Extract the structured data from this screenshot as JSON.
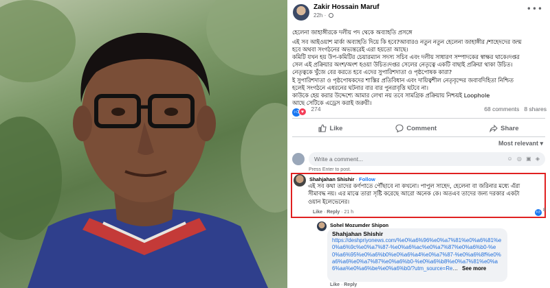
{
  "post": {
    "author": "Zakir Hossain Maruf",
    "time": "22h",
    "more_icon": "more-dots-icon",
    "body_lines": [
      "হেলেনা জাহাঙ্গীরকে দলীয় পদ থেকে অব্যাহতি প্রসঙ্গে",
      "এই সব আইওয়াশ মার্কা অব্যাহতি দিয়ে কি হবে?আবারও নতুন নতুন হেলেনা জাহাঙ্গীর /শাহেদদের জন্ম",
      "হবে অথবা সংগঠনের অভ্যন্তরেই এরা হয়তো আছে।",
      "কমিটি যখন হয় উপ-কমিটির চেয়ারম্যান সদস্য সচিব এবং দলীয় সাধারণ সম্পাদকের স্বাক্ষর থাকে।দপ্তর",
      "সেল এই প্রক্রিয়ার অংশ/অংশ হওয়া উচিত।দপ্তর সেলের নেতৃত্বে একটি বাছাই প্রক্রিয়া থাকা উচিত।",
      "নেতৃত্বকে খুঁজে বের করতে হবে এদের সুপারিশদাতা ও পৃষ্ঠপোষক কারা?",
      "ই সুপারিশদাতা ও পৃষ্ঠপোষকদের শাস্তির প্রতিবিধান এবং দায়িত্বশীল নেতৃবৃন্দের জবাবদিহিতা নিশ্চিত",
      "হলেই সংগঠনে এধরনের ঘটনার বার বার পুনরাবৃত্তি ঘটবে না।",
      "কাউকে হেয় করার উদ্দেশ্যে আমার লেখা নয় তবে সামগ্রিক প্রক্রিয়ায় নিশ্চয়ই Loophole",
      "আছে সেটিকে এড্রেস করাই জরুরী।"
    ],
    "reaction_count": "274",
    "comments_count": "68 comments",
    "shares_count": "8 shares",
    "actions": {
      "like": "Like",
      "comment": "Comment",
      "share": "Share"
    },
    "sort_label": "Most relevant",
    "composer_placeholder": "Write a comment...",
    "composer_hint": "Press Enter to post."
  },
  "comment": {
    "author": "Shahjahan Shishir",
    "follow": "Follow",
    "text": "এই সব কথা তাদের কর্ণপাতে পৌঁছাবে না কখনো। পাপুল সাহেদ, হেলেনা বা জরিনার মধ্যে এঁরা সীমাবদ্ধ নয়। এর মাঝে তারা সৃষ্টি করেছে আরো অনেক কে। অতএব তাদের জন্য দরকার একটা ওয়ান ইলেভেনের।",
    "like_label": "Like",
    "reply_label": "Reply",
    "time": "21 h",
    "reaction_count": "8"
  },
  "reply": {
    "author": "Sohel Mozumder Shipon",
    "mention": "Shahjahan Shishir",
    "link": "https://deshpriyonews.com/%e0%a6%96%e0%a7%81%e0%a6%81%e0%a6%9c%e0%a7%87-%e0%a6%ac%e0%a7%87%e0%a6%b0-%e0%a6%95%e0%a6%b0%e0%a6%a4%e0%a7%87-%e0%a6%8f%e0%a6%a6%e0%a7%87%e0%a6%b0-%e0%a6%b8%e0%a7%81%e0%a6%aa%e0%a6%be%e0%a6%b0/?utm_source=Re",
    "see_more": "See more",
    "like_label": "Like",
    "reply_label": "Reply"
  }
}
